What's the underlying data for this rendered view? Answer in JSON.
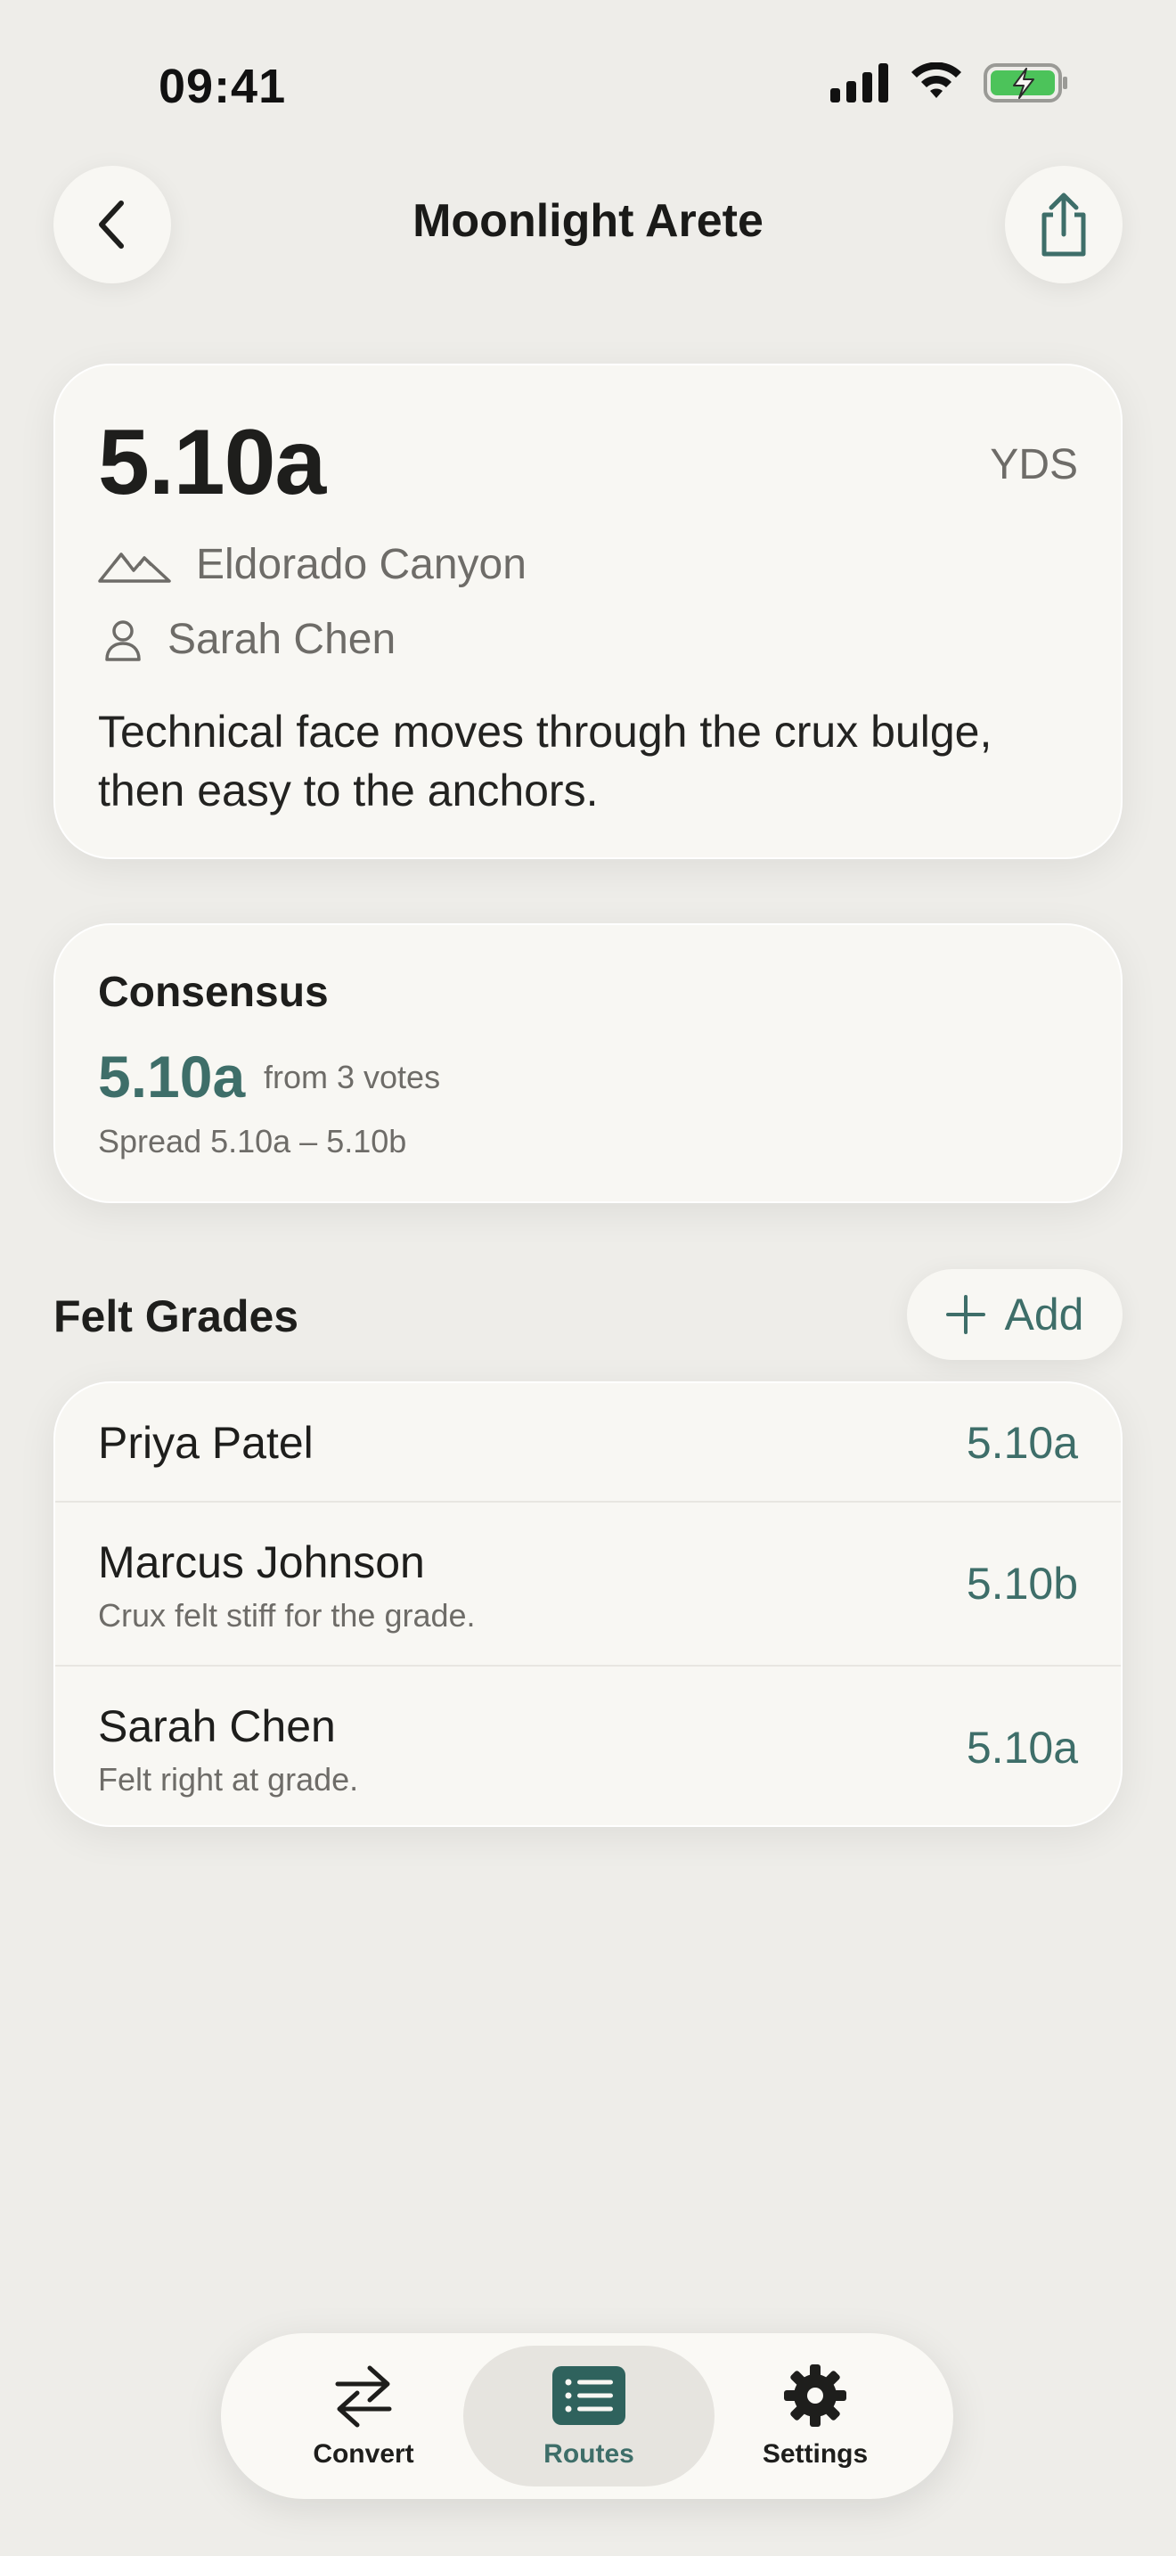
{
  "status_bar": {
    "time": "09:41"
  },
  "nav": {
    "title": "Moonlight Arete"
  },
  "route": {
    "grade": "5.10a",
    "scale": "YDS",
    "area": "Eldorado Canyon",
    "setter": "Sarah Chen",
    "description": "Technical face moves through the crux bulge, then easy to the anchors."
  },
  "consensus": {
    "title": "Consensus",
    "grade": "5.10a",
    "votes": "from 3 votes",
    "spread": "Spread 5.10a – 5.10b"
  },
  "felt_grades": {
    "title": "Felt Grades",
    "add_label": "Add",
    "items": [
      {
        "name": "Priya Patel",
        "note": "",
        "grade": "5.10a"
      },
      {
        "name": "Marcus Johnson",
        "note": "Crux felt stiff for the grade.",
        "grade": "5.10b"
      },
      {
        "name": "Sarah Chen",
        "note": "Felt right at grade.",
        "grade": "5.10a"
      }
    ]
  },
  "tab_bar": {
    "tabs": [
      {
        "label": "Convert",
        "icon": "arrows-left-right-icon"
      },
      {
        "label": "Routes",
        "icon": "list-icon",
        "selected": true
      },
      {
        "label": "Settings",
        "icon": "gear-icon"
      }
    ]
  },
  "colors": {
    "accent": "#3E6E69",
    "background": "#EEEDE9",
    "card": "#F8F7F3"
  }
}
